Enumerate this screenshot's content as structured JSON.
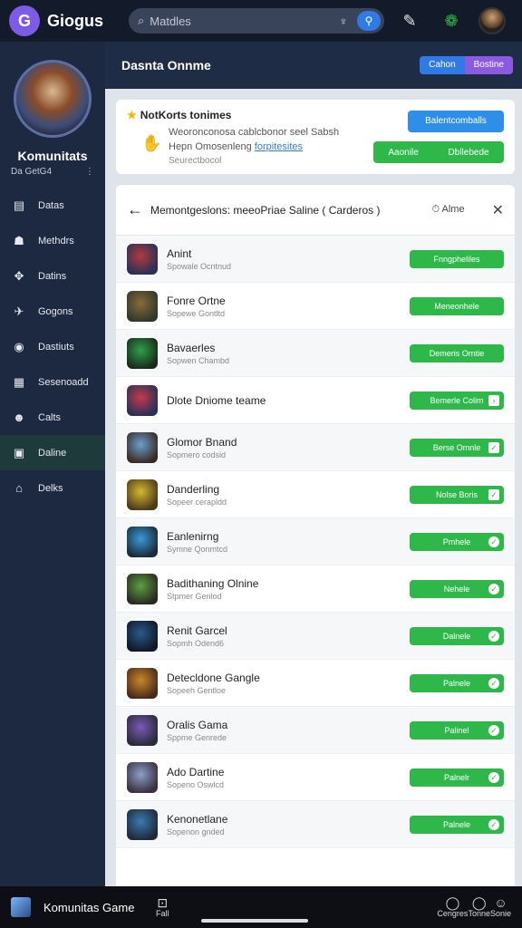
{
  "topbar": {
    "app_name": "Giogus",
    "logo_glyph": "G",
    "search_placeholder": "Matdles",
    "search_button": "⚲"
  },
  "sidebar": {
    "profile_name": "Komunitats",
    "profile_sub": "Da GetG4",
    "items": [
      {
        "label": "Datas",
        "icon": "▤"
      },
      {
        "label": "Methdrs",
        "icon": "☗"
      },
      {
        "label": "Datins",
        "icon": "✥"
      },
      {
        "label": "Gogons",
        "icon": "✈"
      },
      {
        "label": "Dastiuts",
        "icon": "◉"
      },
      {
        "label": "Sesenoadd",
        "icon": "▦"
      },
      {
        "label": "Calts",
        "icon": "☻"
      },
      {
        "label": "Daline",
        "icon": "▣"
      },
      {
        "label": "Delks",
        "icon": "⌂"
      }
    ],
    "active_index": 7
  },
  "header": {
    "title": "Dasnta Onnme",
    "seg_a": "Cahon",
    "seg_b": "Bostine"
  },
  "notice": {
    "title": "NotKorts tonimes",
    "line1": "Weoronconosa cablcbonor seel Sabsh",
    "line2_a": "Hepn Omosenleng",
    "line2_link": "forpitesites",
    "line3": "Seurectbocol",
    "button_primary": "Balentcomballs",
    "button_secondary_a": "Aaonile",
    "button_secondary_b": "Dbllebede"
  },
  "panel": {
    "title": "Memontgeslons: meeoPriae Saline ( Carderos )",
    "clock_label": "Alme",
    "rows": [
      {
        "name": "Anint",
        "sub": "Spowale Ocntnud",
        "button": "Fnngpheliles",
        "mark": "",
        "colors": [
          "#b03b3b",
          "#2b2f5a"
        ]
      },
      {
        "name": "Fonre Ortne",
        "sub": "Sopewe Gontltd",
        "button": "Meneonhele",
        "mark": "",
        "colors": [
          "#8a6a3a",
          "#2e3a2a"
        ]
      },
      {
        "name": "Bavaerles",
        "sub": "Sopwen Chambd",
        "button": "Demeris Orntie",
        "mark": "",
        "colors": [
          "#2ea04a",
          "#1a2a1a"
        ]
      },
      {
        "name": "Dlote Dniome teame",
        "sub": "",
        "button": "Bemerle Colim",
        "mark": "›",
        "colors": [
          "#c63a4a",
          "#28305a"
        ]
      },
      {
        "name": "Glomor Bnand",
        "sub": "Sopmero codsid",
        "button": "Berse Omnle",
        "mark": "✓",
        "colors": [
          "#6aa0d0",
          "#3a2a22"
        ]
      },
      {
        "name": "Danderling",
        "sub": "Sopeer cerapldd",
        "button": "Nolse Boris",
        "mark": "✓",
        "colors": [
          "#d8b830",
          "#4a3a1a"
        ]
      },
      {
        "name": "Eanlenirng",
        "sub": "Symne Qonmtcd",
        "button": "Pmhele",
        "mark": "○",
        "colors": [
          "#3a9ad8",
          "#1a2a3a"
        ]
      },
      {
        "name": "Badithaning Olnine",
        "sub": "Stpmer Genlod",
        "button": "Nehele",
        "mark": "○",
        "colors": [
          "#5aa040",
          "#2a2a22"
        ]
      },
      {
        "name": "Renit Garcel",
        "sub": "Sopmh Odend6",
        "button": "Dalnele",
        "mark": "○",
        "colors": [
          "#2a5a8a",
          "#101828"
        ]
      },
      {
        "name": "Detecldone Gangle",
        "sub": "Sopeeh Gentloe",
        "button": "Palnele",
        "mark": "○",
        "colors": [
          "#c8882a",
          "#4a2a1a"
        ]
      },
      {
        "name": "Oralis Gama",
        "sub": "Sppme Genrede",
        "button": "Palinel",
        "mark": "○",
        "colors": [
          "#7a5ab8",
          "#2a2a3a"
        ]
      },
      {
        "name": "Ado Dartine",
        "sub": "Sopeno Oswlcd",
        "button": "Palnelr",
        "mark": "○",
        "colors": [
          "#8aa0c8",
          "#3a3040"
        ]
      },
      {
        "name": "Kenonetlane",
        "sub": "Sopenon gnded",
        "button": "Palnele",
        "mark": "○",
        "colors": [
          "#3a7ab0",
          "#20283a"
        ]
      }
    ]
  },
  "bottom": {
    "title": "Komunitas Game",
    "nav": [
      {
        "label": "Fall",
        "icon": "⊡"
      },
      {
        "label": "Cengres",
        "icon": "◯"
      },
      {
        "label": "Tonne",
        "icon": "◯"
      },
      {
        "label": "Sonie",
        "icon": "☺"
      }
    ]
  },
  "colors": {
    "accent_blue": "#2f7ae5",
    "accent_green": "#2fb84a",
    "accent_purple": "#8a5be0",
    "sidebar_bg": "#1c2940"
  }
}
